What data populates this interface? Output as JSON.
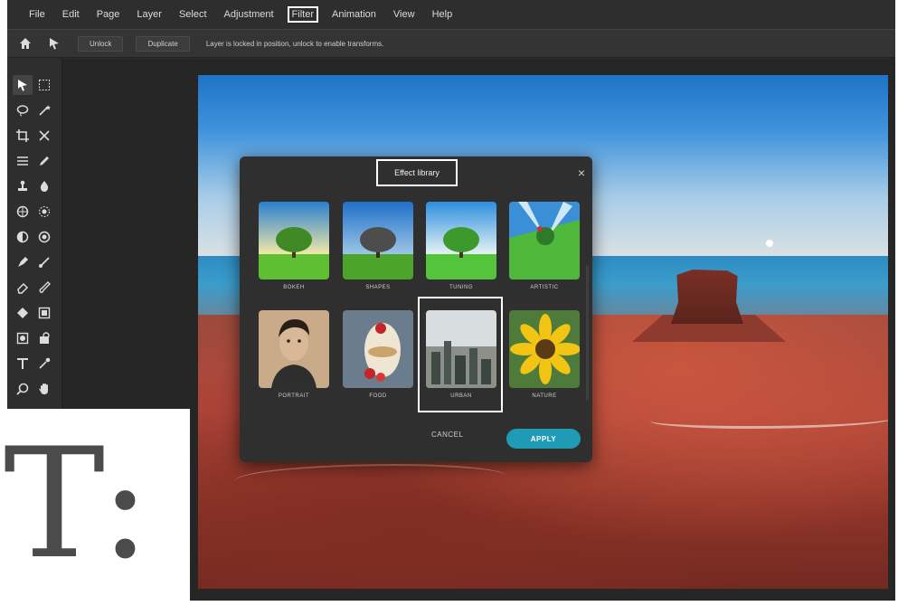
{
  "menu": {
    "items": [
      {
        "label": "File"
      },
      {
        "label": "Edit"
      },
      {
        "label": "Page"
      },
      {
        "label": "Layer"
      },
      {
        "label": "Select"
      },
      {
        "label": "Adjustment"
      },
      {
        "label": "Filter",
        "active": true
      },
      {
        "label": "Animation"
      },
      {
        "label": "View"
      },
      {
        "label": "Help"
      }
    ]
  },
  "options_bar": {
    "unlock_label": "Unlock",
    "duplicate_label": "Duplicate",
    "message": "Layer is locked in position, unlock to enable transforms."
  },
  "tools": [
    "move-tool-icon",
    "marquee-tool-icon",
    "lasso-tool-icon",
    "magic-wand-icon",
    "crop-tool-icon",
    "cut-tool-icon",
    "lines-tool-icon",
    "pencil-tool-icon",
    "clone-stamp-icon",
    "blur-drop-icon",
    "sponge-icon",
    "spot-heal-icon",
    "dodge-icon",
    "burn-icon",
    "pen-tool-icon",
    "brush-tool-icon",
    "eraser-icon",
    "smudge-icon",
    "paint-bucket-icon",
    "gradient-icon",
    "shape-icon",
    "fill-icon",
    "text-tool-icon",
    "eyedropper-icon",
    "zoom-icon",
    "hand-icon"
  ],
  "dialog": {
    "title": "Effect library",
    "close": "×",
    "cancel_label": "CANCEL",
    "apply_label": "APPLY",
    "thumbnails": [
      {
        "label": "BOKEH"
      },
      {
        "label": "SHAPES"
      },
      {
        "label": "TUNING"
      },
      {
        "label": "ARTISTIC"
      },
      {
        "label": "PORTRAIT"
      },
      {
        "label": "FOOD"
      },
      {
        "label": "URBAN",
        "selected": true
      },
      {
        "label": "NATURE"
      }
    ]
  },
  "overlay": {
    "logo": "T:"
  },
  "colors": {
    "accent": "#1f9bb6",
    "panel": "#2f2f2f",
    "chrome": "#2e2e2e"
  }
}
